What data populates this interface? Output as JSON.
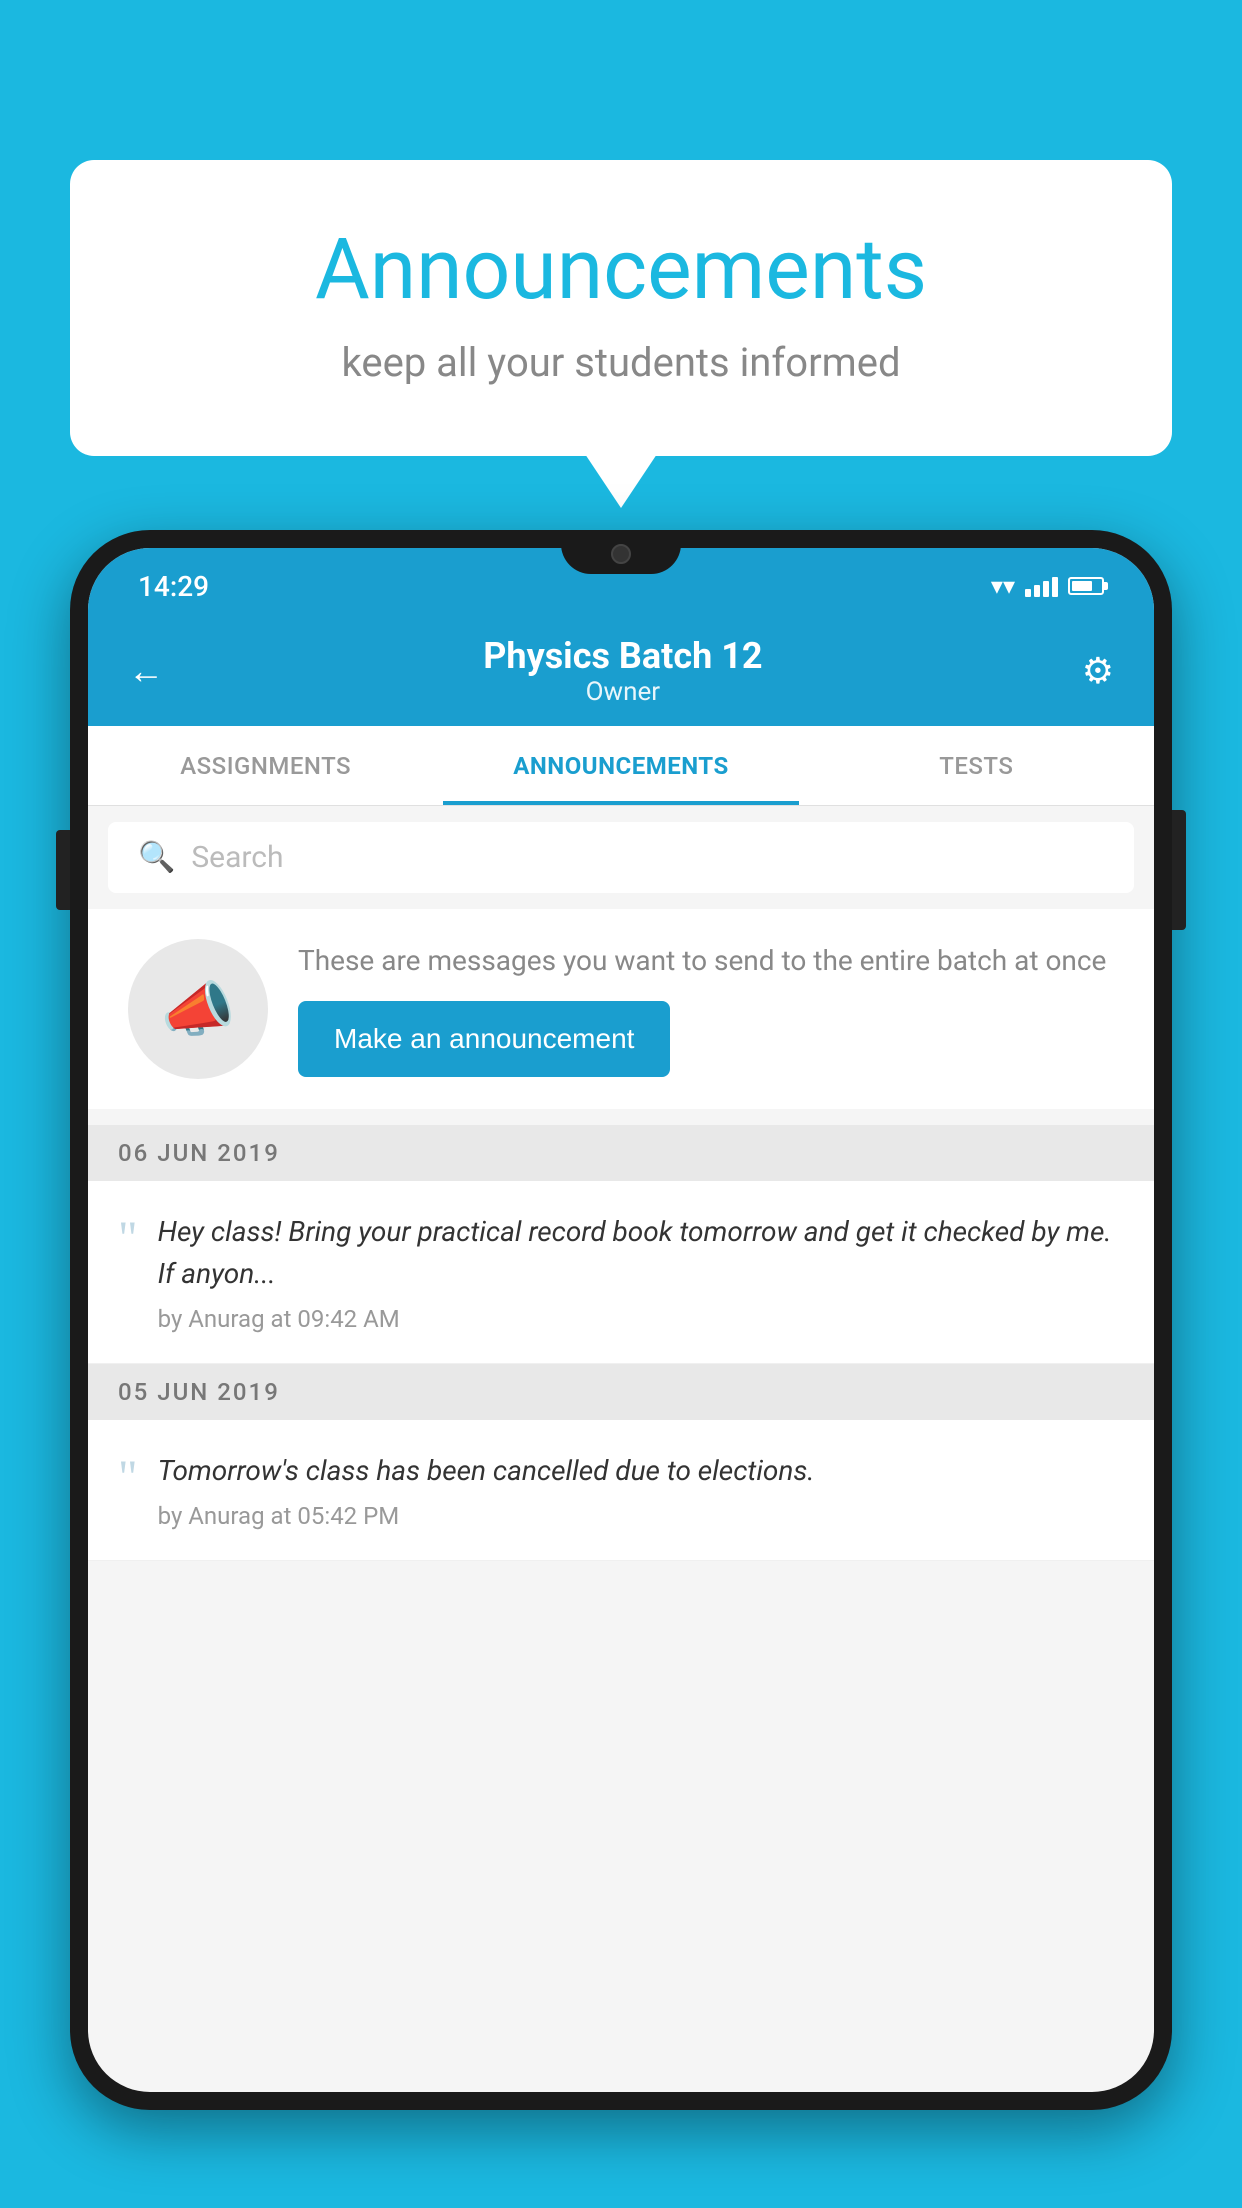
{
  "background_color": "#1bb8e0",
  "speech_bubble": {
    "title": "Announcements",
    "subtitle": "keep all your students informed"
  },
  "phone": {
    "status_bar": {
      "time": "14:29"
    },
    "header": {
      "title": "Physics Batch 12",
      "subtitle": "Owner",
      "back_label": "←",
      "gear_label": "⚙"
    },
    "tabs": [
      {
        "label": "ASSIGNMENTS",
        "active": false
      },
      {
        "label": "ANNOUNCEMENTS",
        "active": true
      },
      {
        "label": "TESTS",
        "active": false
      }
    ],
    "search": {
      "placeholder": "Search"
    },
    "promo": {
      "description": "These are messages you want to send to the entire batch at once",
      "button_label": "Make an announcement"
    },
    "announcements": [
      {
        "date": "06  JUN  2019",
        "text": "Hey class! Bring your practical record book tomorrow and get it checked by me. If anyon...",
        "meta": "by Anurag at 09:42 AM"
      },
      {
        "date": "05  JUN  2019",
        "text": "Tomorrow's class has been cancelled due to elections.",
        "meta": "by Anurag at 05:42 PM"
      }
    ]
  }
}
